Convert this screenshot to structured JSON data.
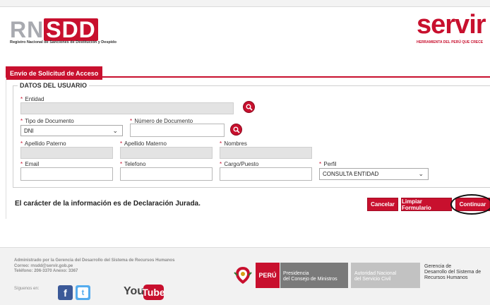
{
  "header": {
    "logo_rn": "RN",
    "logo_sdd": "SDD",
    "logo_subtitle": "Registro Nacional de Sanciones de Destitución y Despido",
    "servir_logo": "servir",
    "servir_subtitle": "HERRAMIENTA DEL PERÚ QUE CRECE"
  },
  "tab": {
    "label": "Envío de Solicitud de Acceso"
  },
  "form": {
    "legend": "DATOS DEL USUARIO",
    "required_mark": "*",
    "fields": {
      "entidad": {
        "label": "Entidad",
        "value": ""
      },
      "tipo_documento": {
        "label": "Tipo de Documento",
        "value": "DNI"
      },
      "numero_documento": {
        "label": "Número de Documento",
        "value": ""
      },
      "apellido_paterno": {
        "label": "Apellido Paterno",
        "value": ""
      },
      "apellido_materno": {
        "label": "Apellido Materno",
        "value": ""
      },
      "nombres": {
        "label": "Nombres",
        "value": ""
      },
      "email": {
        "label": "Email",
        "value": ""
      },
      "telefono": {
        "label": "Telefono",
        "value": ""
      },
      "cargo_puesto": {
        "label": "Cargo/Puesto",
        "value": ""
      },
      "perfil": {
        "label": "Perfil",
        "value": "CONSULTA ENTIDAD"
      }
    },
    "icons": {
      "search": "search-icon",
      "chevron": "chevron-down-icon"
    }
  },
  "declaration": "El carácter de la información es de Declaración Jurada.",
  "buttons": {
    "cancel": "Cancelar",
    "clear": "Limpiar Formulario",
    "continue": "Continuar"
  },
  "footer": {
    "admin_line1": "Administrado por la Gerencia del Desarrollo del Sistema de Recursos Humanos",
    "admin_line2": "Correo: rnsdd@servir.gob.pe",
    "admin_line3": "Teléfono: 206-3370 Anexo: 3367",
    "follow_label": "Síguenos en:",
    "facebook": "f",
    "twitter": "t",
    "youtube_you": "You",
    "youtube_tube": "Tube",
    "peru": "PERÚ",
    "pcm_line1": "Presidencia",
    "pcm_line2": "del Consejo de Ministros",
    "anc_line1": "Autoridad Nacional",
    "anc_line2": "del Servicio Civil",
    "grh_line1": "Gerencia de",
    "grh_line2": "Desarrollo del Sistema de",
    "grh_line3": "Recursos Humanos"
  },
  "colors": {
    "brand_red": "#c8102e",
    "readonly_gray": "#e3e3e3"
  }
}
